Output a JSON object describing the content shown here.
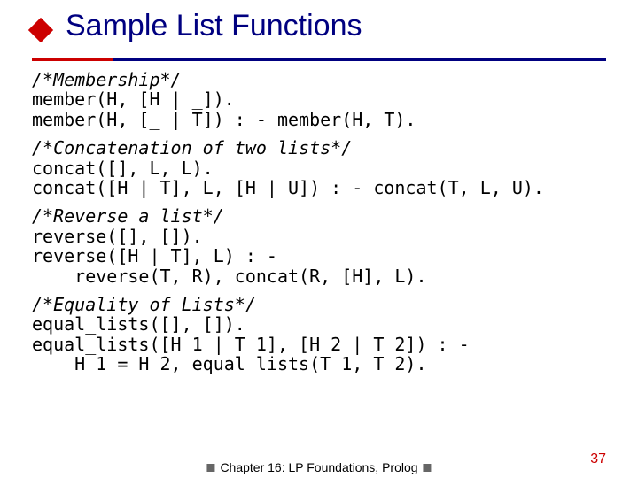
{
  "title": "Sample List Functions",
  "blocks": [
    {
      "comment": "/*Membership*/",
      "lines": [
        "member(H, [H | _]).",
        "member(H, [_ | T]) : - member(H, T)."
      ]
    },
    {
      "comment": "/*Concatenation of two lists*/",
      "lines": [
        "concat([], L, L).",
        "concat([H | T], L, [H | U]) : - concat(T, L, U)."
      ]
    },
    {
      "comment": "/*Reverse a list*/",
      "lines": [
        "reverse([], []).",
        "reverse([H | T], L) : -",
        "    reverse(T, R), concat(R, [H], L)."
      ]
    },
    {
      "comment": "/*Equality of Lists*/",
      "lines": [
        "equal_lists([], []).",
        "equal_lists([H 1 | T 1], [H 2 | T 2]) : -",
        "    H 1 = H 2, equal_lists(T 1, T 2)."
      ]
    }
  ],
  "footer": {
    "chapter": "Chapter 16: LP Foundations, Prolog",
    "page": "37"
  }
}
